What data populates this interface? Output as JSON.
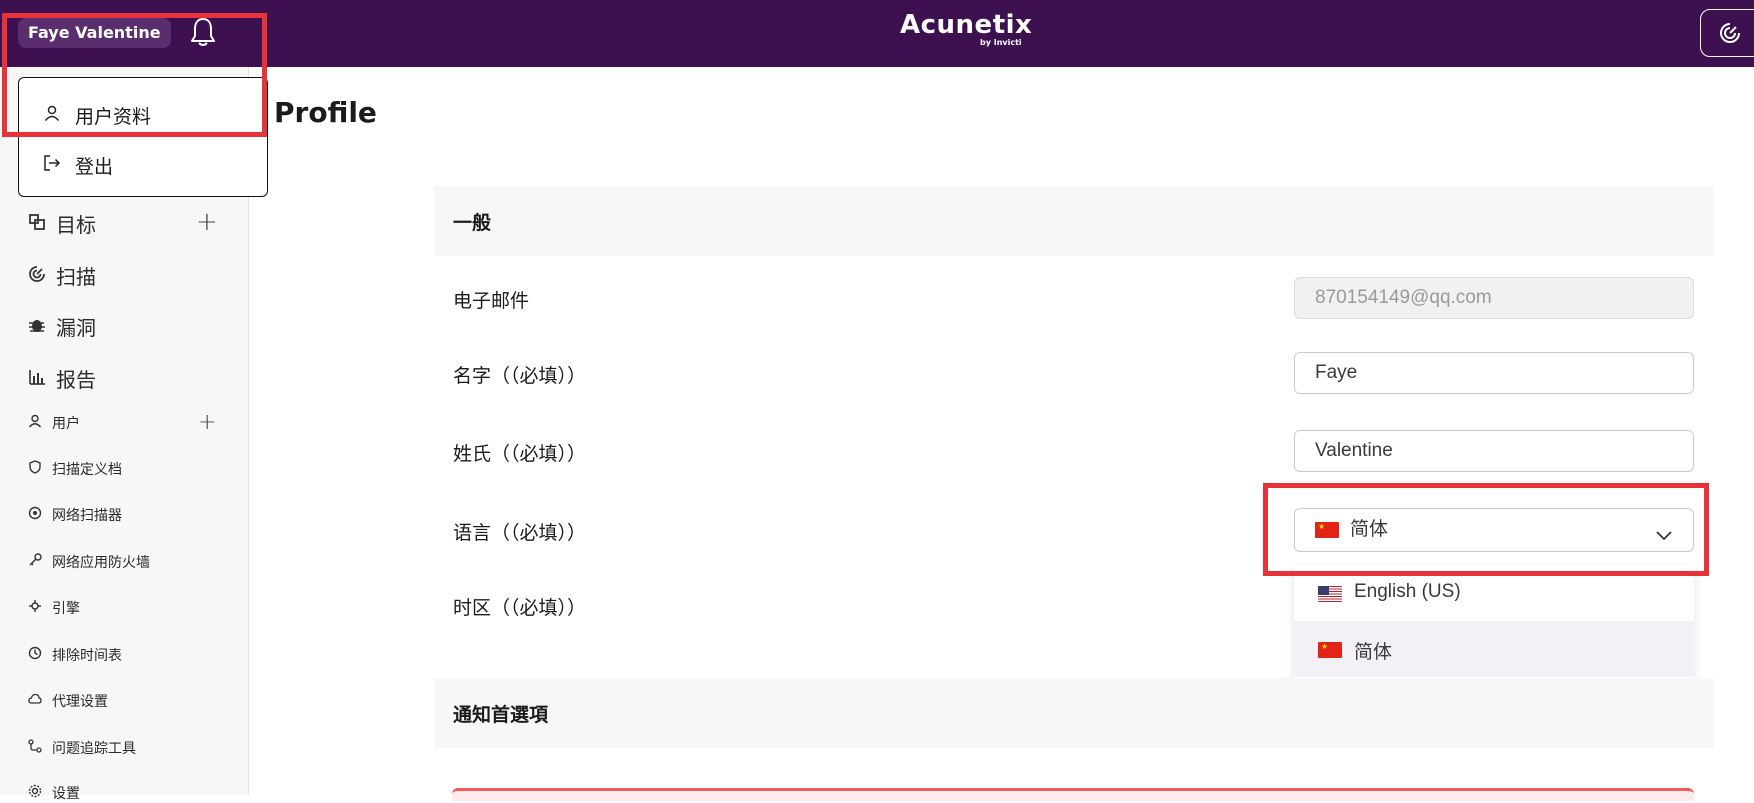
{
  "header": {
    "user_name": "Faye Valentine",
    "logo_text": "Acunetix",
    "logo_sub": "by Invicti"
  },
  "user_menu": {
    "items": [
      {
        "label": "用户资料",
        "icon": "user-icon"
      },
      {
        "label": "登出",
        "icon": "logout-icon"
      }
    ]
  },
  "sidebar": {
    "items": [
      {
        "label": "目标",
        "icon": "targets-icon",
        "has_add": true
      },
      {
        "label": "扫描",
        "icon": "scan-icon"
      },
      {
        "label": "漏洞",
        "icon": "bug-icon"
      },
      {
        "label": "报告",
        "icon": "chart-icon"
      },
      {
        "label": "用户",
        "icon": "user-icon",
        "has_add": true
      },
      {
        "label": "扫描定义档",
        "icon": "shield-icon"
      },
      {
        "label": "网络扫描器",
        "icon": "network-scanner-icon"
      },
      {
        "label": "网络应用防火墙",
        "icon": "key-icon"
      },
      {
        "label": "引擎",
        "icon": "engine-icon"
      },
      {
        "label": "排除时间表",
        "icon": "clock-icon"
      },
      {
        "label": "代理设置",
        "icon": "cloud-icon"
      },
      {
        "label": "问题追踪工具",
        "icon": "tracker-icon"
      },
      {
        "label": "设置",
        "icon": "gear-icon"
      }
    ]
  },
  "main": {
    "title": "Profile",
    "general_section": "一般",
    "fields": {
      "email_label": "电子邮件",
      "email_value": "870154149@qq.com",
      "first_name_label": "名字（（必填））",
      "first_name_value": "Faye",
      "last_name_label": "姓氏（（必填））",
      "last_name_value": "Valentine",
      "language_label": "语言（（必填））",
      "language_value": "简体",
      "timezone_label": "时区（（必填））"
    },
    "language_options": [
      {
        "label": "English (US)",
        "flag": "us-flag-icon"
      },
      {
        "label": "简体",
        "flag": "cn-flag-icon",
        "selected": true
      }
    ],
    "notification_section": "通知首選項"
  },
  "colors": {
    "topbar": "#3d1150",
    "highlight": "#e8323a",
    "selected_option": "#f4f0f8"
  }
}
